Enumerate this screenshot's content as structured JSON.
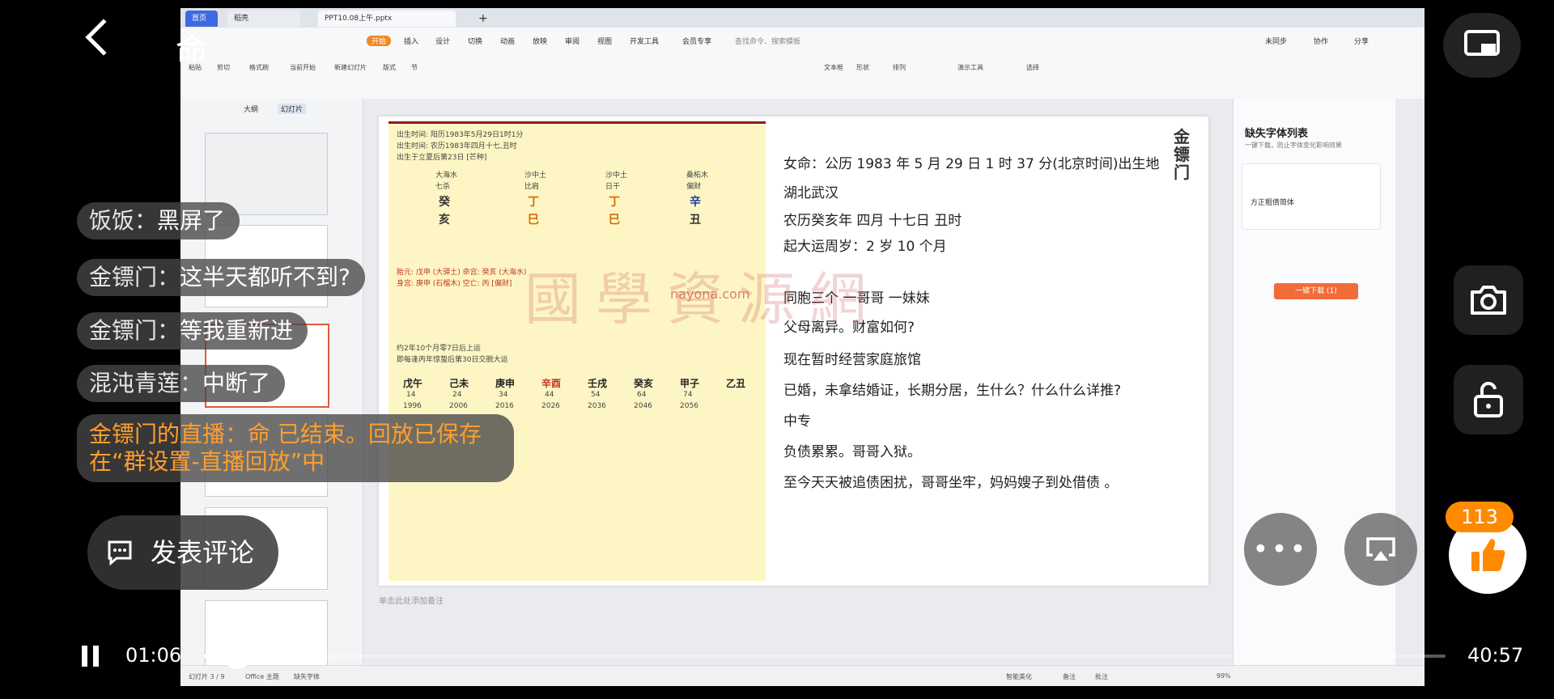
{
  "wps": {
    "tabs": [
      "首页",
      "稻壳",
      "PPT10.08上午.pptx"
    ],
    "menu": [
      "开始",
      "插入",
      "设计",
      "切换",
      "动画",
      "放映",
      "审阅",
      "视图",
      "开发工具",
      "会员专享"
    ],
    "search_placeholder": "查找命令、搜索模板",
    "topright": [
      "未同步",
      "协作",
      "分享"
    ],
    "tools": [
      "粘贴",
      "剪切",
      "格式刷",
      "当前开始",
      "新建幻灯片",
      "版式",
      "节",
      "文本框",
      "形状",
      "排列",
      "演示工具",
      "选择"
    ],
    "thumb_tabs": [
      "大纲",
      "幻灯片"
    ],
    "statusbar": [
      "幻灯片 3 / 9",
      "Office 主题",
      "缺失字体",
      "智能美化",
      "备注",
      "批注",
      "99%"
    ],
    "notes_placeholder": "单击此处添加备注"
  },
  "chart": {
    "birth_lines": [
      "出生时间: 阳历1983年5月29日1时1分",
      "出生时间: 农历1983年四月十七,丑时",
      "出生于立夏后第23日 [芒种]"
    ],
    "columns_top": [
      "大海水",
      "沙中土",
      "沙中土",
      "桑柘木"
    ],
    "columns_role": [
      "七杀",
      "比肩",
      "日干",
      "偏财"
    ],
    "pillars_top": [
      "癸",
      "丁",
      "丁",
      "辛"
    ],
    "pillars_bottom": [
      "亥",
      "巳",
      "巳",
      "丑"
    ],
    "notes": [
      "胎元: 戊申 (大驿土)  命宫: 癸亥 (大海水)",
      "身宫: 庚申 (石榴木)  空亡: 丙 [偏财]",
      "约2年10个月零7日后上运",
      "即每逢丙年惊蛰后第30日交脱大运"
    ],
    "dayun_labels": [
      "戊午",
      "己未",
      "庚申",
      "辛酉",
      "壬戌",
      "癸亥",
      "甲子",
      "乙丑"
    ],
    "dayun_ages": [
      "14",
      "24",
      "34",
      "44",
      "54",
      "64",
      "74"
    ],
    "dayun_years": [
      "1996",
      "2006",
      "2016",
      "2026",
      "2036",
      "2046",
      "2056"
    ]
  },
  "slide": {
    "vertical_title": "金镖门",
    "lines": [
      "女命：公历 1983 年 5 月 29 日 1 时 37 分(北京时间)出生地",
      "湖北武汉",
      "农历癸亥年 四月 十七日 丑时",
      "起大运周岁：2 岁 10 个月",
      "同胞三个 一哥哥 一妹妹",
      "父母离异。财富如何?",
      "现在暂时经营家庭旅馆",
      "已婚，未拿结婚证，长期分居，生什么？什么什么详推?",
      "中专",
      "负债累累。哥哥入狱。",
      "至今天天被追债困扰，哥哥坐牢，妈妈嫂子到处借债 。"
    ],
    "watermark": "國學資源網",
    "watermark_url": "nayona.com"
  },
  "rpanel": {
    "title": "缺失字体列表",
    "hint": "一键下载，防止字体变化影响效果",
    "font_item": "方正粗倩简体",
    "button": "一键下载 (1)"
  },
  "overlay": {
    "room_title": "命",
    "chats": [
      {
        "nick": "饭饭：",
        "text": "黑屏了"
      },
      {
        "nick": "金镖门：",
        "text": "这半天都听不到?"
      },
      {
        "nick": "金镖门：",
        "text": "等我重新进"
      },
      {
        "nick": "混沌青莲：",
        "text": "中断了"
      }
    ],
    "ended_notice": "金镖门的直播：命 已结束。回放已保存在“群设置-直播回放”中",
    "comment_label": "发表评论",
    "like_count": "113",
    "time_current": "01:06",
    "time_total": "40:57",
    "progress": 0.027,
    "colors": {
      "accent": "#ff9e2c",
      "like": "#ff8a00"
    }
  }
}
